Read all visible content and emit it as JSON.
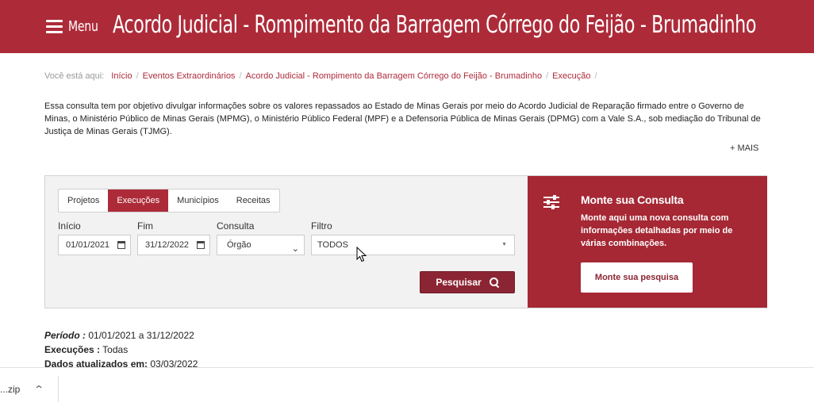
{
  "header": {
    "menu_label": "Menu",
    "title": "Acordo Judicial - Rompimento da Barragem Córrego do Feijão - Brumadinho"
  },
  "breadcrumb": {
    "prefix": "Você está aqui:",
    "items": [
      "Início",
      "Eventos Extraordinários",
      "Acordo Judicial - Rompimento da Barragem Córrego do Feijão - Brumadinho",
      "Execução"
    ],
    "separator": "/"
  },
  "intro_text": "Essa consulta tem por objetivo divulgar informações sobre os valores repassados ao Estado de Minas Gerais por meio do Acordo Judicial de Reparação firmado entre o Governo de Minas, o Ministério Público de Minas Gerais (MPMG), o Ministério Público Federal (MPF) e a Defensoria Pública de Minas Gerais (DPMG) com a Vale S.A., sob mediação do Tribunal de Justiça de Minas Gerais (TJMG).",
  "more_link": "+ MAIS",
  "query_panel": {
    "tabs": [
      {
        "label": "Projetos",
        "active": false
      },
      {
        "label": "Execuções",
        "active": true
      },
      {
        "label": "Municípios",
        "active": false
      },
      {
        "label": "Receitas",
        "active": false
      }
    ],
    "inicio": {
      "label": "Início",
      "value": "01/01/2021"
    },
    "fim": {
      "label": "Fim",
      "value": "31/12/2022"
    },
    "consulta": {
      "label": "Consulta",
      "value": "Órgão"
    },
    "filtro": {
      "label": "Filtro",
      "value": "TODOS"
    },
    "search_button": "Pesquisar"
  },
  "custom_query": {
    "title": "Monte sua Consulta",
    "description": "Monte aqui uma nova consulta com informações detalhadas por meio de várias combinações.",
    "button": "Monte sua pesquisa"
  },
  "results_info": {
    "periodo_label": "Período :",
    "periodo_value": "01/01/2021 a 31/12/2022",
    "execucoes_label": "Execuções :",
    "execucoes_value": "Todas",
    "atualizados_label": "Dados atualizados em:",
    "atualizados_value": "03/03/2022"
  },
  "download_bar": {
    "file_name": "...zip"
  },
  "colors": {
    "brand": "#ad2b39",
    "brand_dark": "#8c2533",
    "panel_right": "#a52834"
  }
}
